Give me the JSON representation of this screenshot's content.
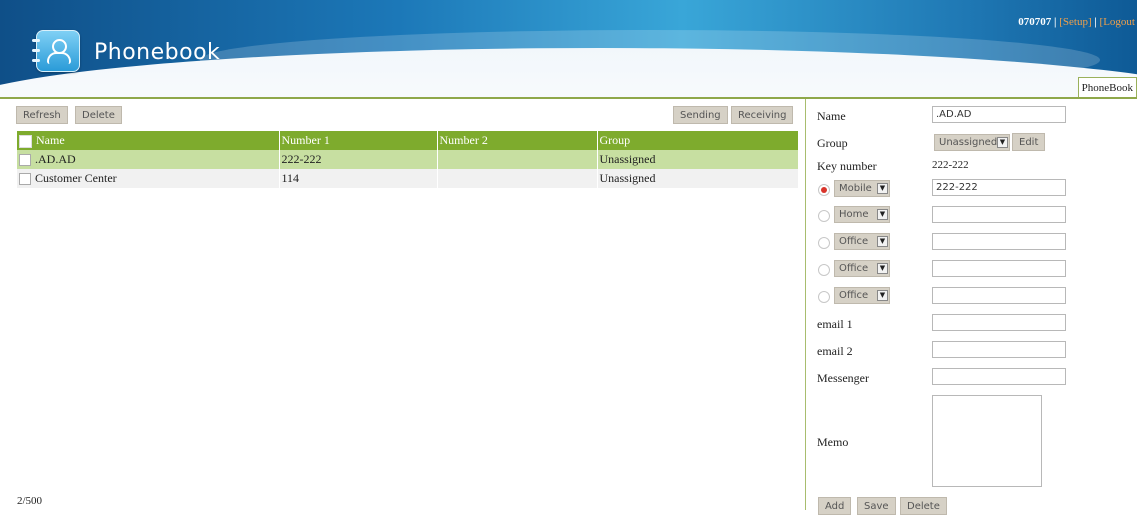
{
  "app": {
    "title": "Phonebook"
  },
  "user": {
    "id": "070707",
    "sep1": " | ",
    "setup": "[Setup]",
    "sep2": " | ",
    "logout": "[Logout"
  },
  "tab": {
    "label": "PhoneBook"
  },
  "toolbar": {
    "refresh": "Refresh",
    "delete": "Delete",
    "sending": "Sending",
    "receiving": "Receiving"
  },
  "table": {
    "headers": [
      "Name",
      "Number 1",
      "Number 2",
      "Group"
    ],
    "rows": [
      {
        "name": ".AD.AD",
        "number1": "222-222",
        "number2": "",
        "group": "Unassigned"
      },
      {
        "name": "Customer Center",
        "number1": "114",
        "number2": "",
        "group": "Unassigned"
      }
    ]
  },
  "footer": {
    "count": "2/500"
  },
  "form": {
    "name_label": "Name",
    "name_value": ".AD.AD",
    "group_label": "Group",
    "group_value": "Unassigned",
    "edit": "Edit",
    "key_label": "Key number",
    "key_value": "222-222",
    "phones": [
      {
        "type": "Mobile",
        "value": "222-222",
        "selected": true
      },
      {
        "type": "Home",
        "value": "",
        "selected": false
      },
      {
        "type": "Office",
        "value": "",
        "selected": false
      },
      {
        "type": "Office",
        "value": "",
        "selected": false
      },
      {
        "type": "Office",
        "value": "",
        "selected": false
      }
    ],
    "email1_label": "email 1",
    "email2_label": "email 2",
    "messenger_label": "Messenger",
    "memo_label": "Memo",
    "add": "Add",
    "save": "Save",
    "delete": "Delete"
  },
  "colors": {
    "header_green": "#7eab2d",
    "selected_row": "#c7dfa1",
    "accent_orange": "#f0a04a"
  }
}
